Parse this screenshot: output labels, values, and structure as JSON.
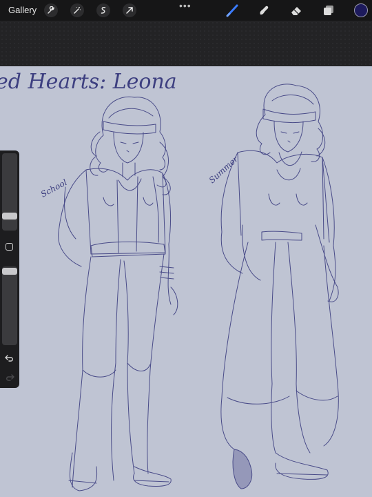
{
  "topbar": {
    "gallery_label": "Gallery",
    "left_tools": [
      "wrench-icon",
      "magic-wand-icon",
      "selection-icon",
      "transform-arrow-icon"
    ],
    "more_label": "•••",
    "right_tools": [
      "brush-icon",
      "smudge-icon",
      "eraser-icon",
      "layers-icon"
    ],
    "current_color": "#1d1a5c"
  },
  "canvas": {
    "background_color": "#bfc4d3",
    "title_text": "ed Hearts: Leona",
    "label_school": "School",
    "label_summer": "Summer",
    "stroke_color": "#3d3f80"
  },
  "sidebar": {
    "brush_size_level": 0.33,
    "opacity_level": 0.95
  }
}
